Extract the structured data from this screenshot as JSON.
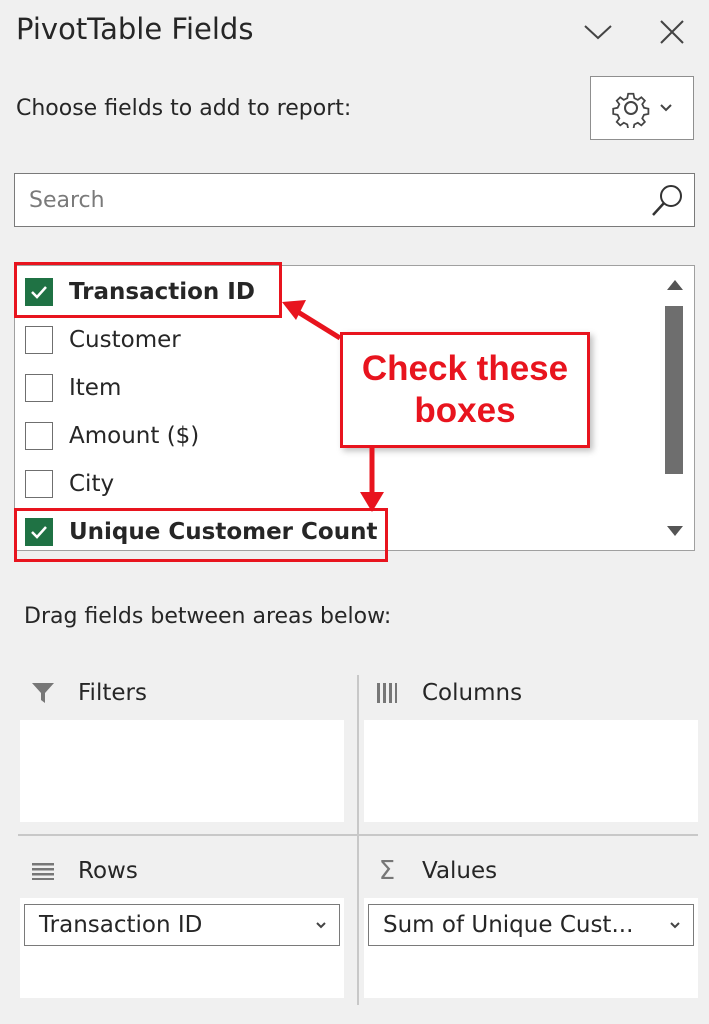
{
  "header": {
    "title": "PivotTable Fields",
    "choose_label": "Choose fields to add to report:"
  },
  "search": {
    "placeholder": "Search",
    "value": ""
  },
  "fields": [
    {
      "label": "Transaction ID",
      "checked": true
    },
    {
      "label": "Customer",
      "checked": false
    },
    {
      "label": "Item",
      "checked": false
    },
    {
      "label": "Amount ($)",
      "checked": false
    },
    {
      "label": "City",
      "checked": false
    },
    {
      "label": "Unique Customer Count",
      "checked": true
    }
  ],
  "annotation": {
    "line1": "Check these",
    "line2": "boxes",
    "color": "#e8141e"
  },
  "areas": {
    "drag_label": "Drag fields between areas below:",
    "filters": {
      "label": "Filters"
    },
    "columns": {
      "label": "Columns"
    },
    "rows": {
      "label": "Rows",
      "items": [
        "Transaction ID"
      ]
    },
    "values": {
      "label": "Values",
      "items": [
        "Sum of Unique Cust..."
      ]
    }
  },
  "colors": {
    "checkbox_checked": "#1f7244",
    "pane_bg": "#f0f0f0"
  },
  "icons": [
    "chevron-down-icon",
    "close-icon",
    "gear-icon",
    "search-icon",
    "filter-icon",
    "columns-icon",
    "rows-icon",
    "sigma-icon",
    "scroll-up-icon",
    "scroll-down-icon"
  ]
}
